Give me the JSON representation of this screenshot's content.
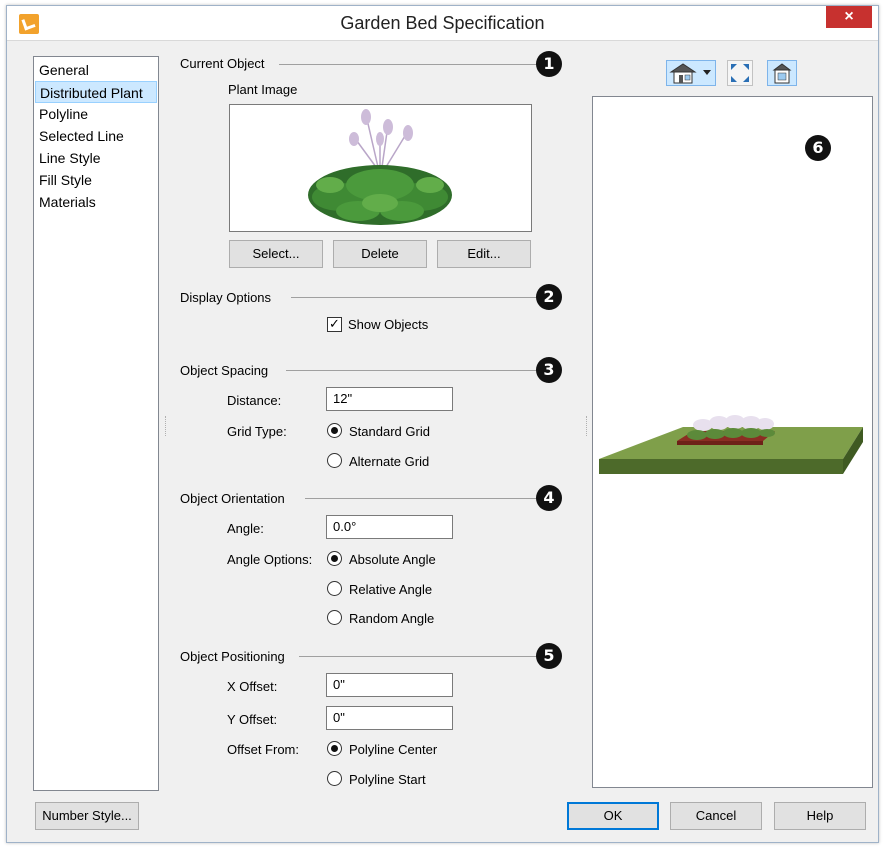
{
  "window": {
    "title": "Garden Bed Specification",
    "close_glyph": "×"
  },
  "nav": {
    "items": [
      "General",
      "Distributed Plant",
      "Polyline",
      "Selected Line",
      "Line Style",
      "Fill Style",
      "Materials"
    ],
    "selected_index": 1
  },
  "current_object": {
    "section_label": "Current Object",
    "badge": "1",
    "plant_image_label": "Plant Image",
    "select_button": "Select...",
    "delete_button": "Delete",
    "edit_button": "Edit..."
  },
  "display_options": {
    "section_label": "Display Options",
    "badge": "2",
    "show_objects_label": "Show Objects",
    "show_objects_checked": true
  },
  "object_spacing": {
    "section_label": "Object Spacing",
    "badge": "3",
    "distance_label": "Distance:",
    "distance_value": "12\"",
    "grid_type_label": "Grid Type:",
    "grid_options": [
      "Standard Grid",
      "Alternate Grid"
    ],
    "grid_selected": 0
  },
  "object_orientation": {
    "section_label": "Object Orientation",
    "badge": "4",
    "angle_label": "Angle:",
    "angle_value": "0.0°",
    "angle_options_label": "Angle Options:",
    "angle_options": [
      "Absolute Angle",
      "Relative Angle",
      "Random Angle"
    ],
    "angle_selected": 0
  },
  "object_positioning": {
    "section_label": "Object Positioning",
    "badge": "5",
    "x_offset_label": "X Offset:",
    "x_offset_value": "0\"",
    "y_offset_label": "Y Offset:",
    "y_offset_value": "0\"",
    "offset_from_label": "Offset From:",
    "offset_options": [
      "Polyline Center",
      "Polyline Start"
    ],
    "offset_selected": 0
  },
  "preview": {
    "badge": "6"
  },
  "footer": {
    "number_style_button": "Number Style...",
    "ok_button": "OK",
    "cancel_button": "Cancel",
    "help_button": "Help"
  },
  "icons": [
    "house-view-icon",
    "dropdown-arrow-icon",
    "fill-window-icon",
    "camera-mode-icon",
    "app-icon",
    "close-icon"
  ],
  "colors": {
    "accent": "#0078d7",
    "close": "#c7312f",
    "selection": "#cce8ff",
    "bed_green": "#6b8f3a"
  }
}
